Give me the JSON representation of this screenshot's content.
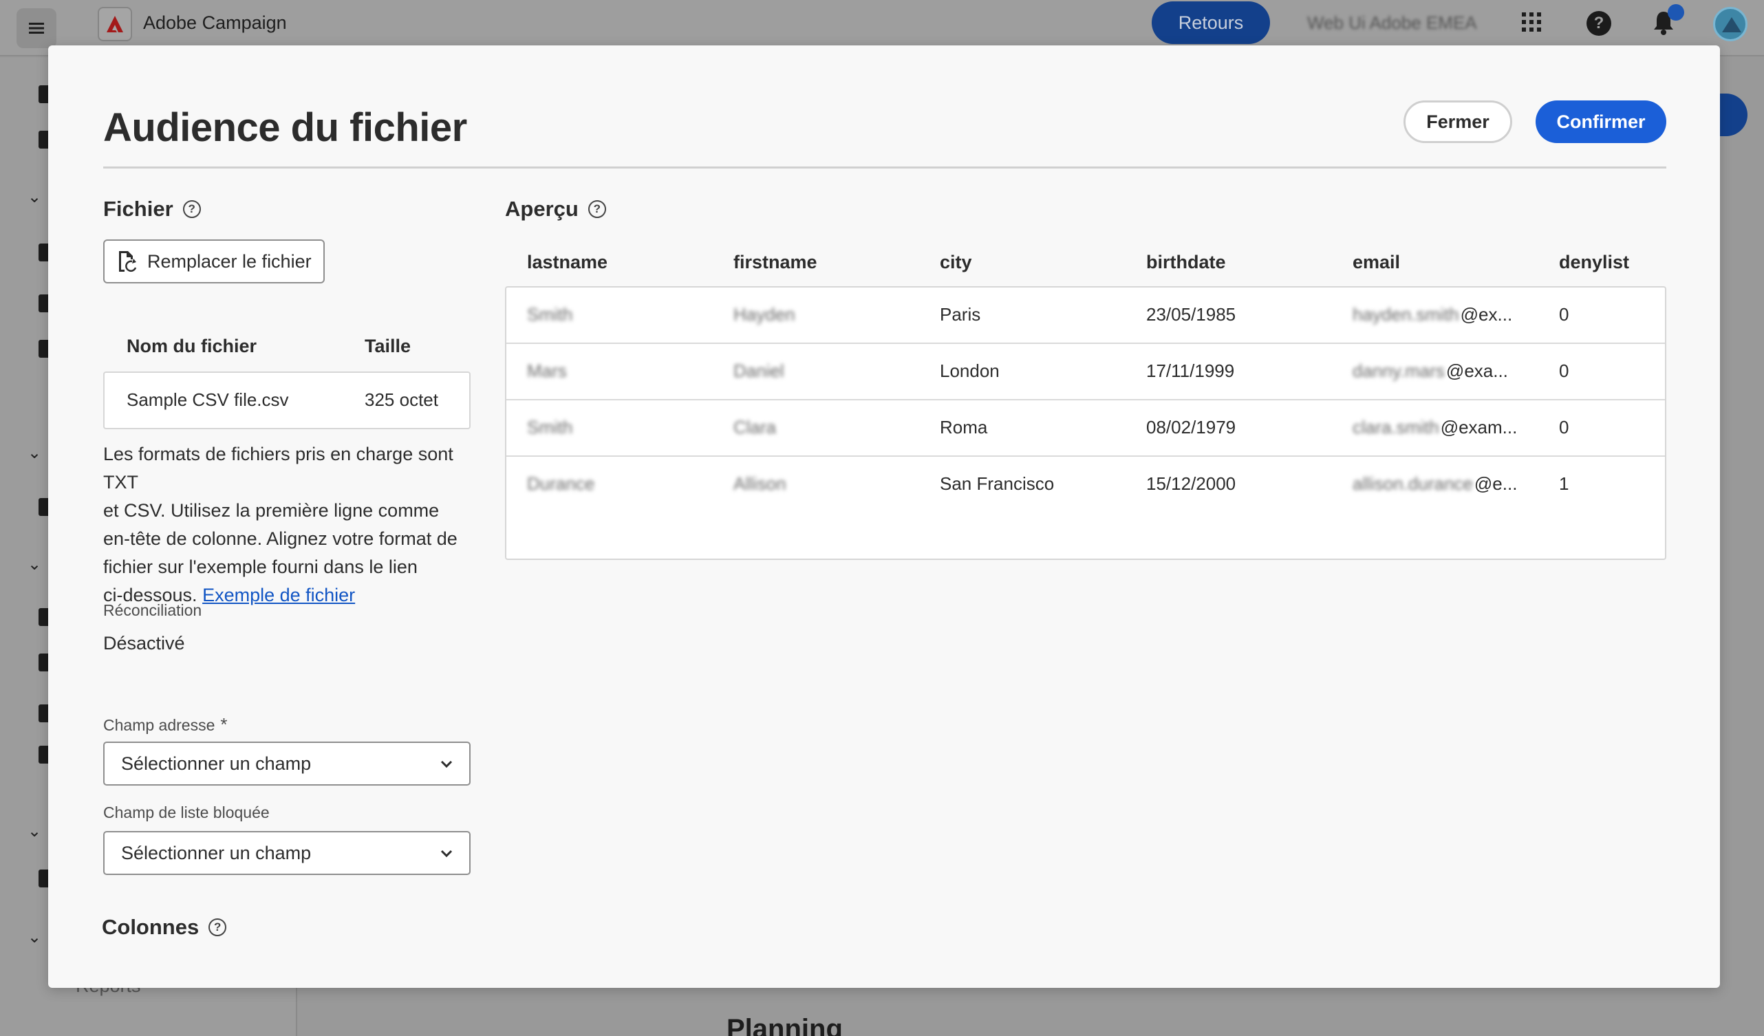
{
  "app": {
    "title": "Adobe Campaign",
    "retours_label": "Retours",
    "org_name": "Web Ui Adobe EMEA",
    "reports_label": "Reports",
    "planning_label": "Planning"
  },
  "modal": {
    "title": "Audience du fichier",
    "close_label": "Fermer",
    "confirm_label": "Confirmer",
    "accent_color": "#1b5fd8"
  },
  "file_section": {
    "heading": "Fichier",
    "replace_label": "Remplacer le fichier",
    "col_name": "Nom du fichier",
    "col_size": "Taille",
    "file_name": "Sample CSV file.csv",
    "file_size": "325 octet",
    "info_line1": "Les formats de fichiers pris en charge sont TXT",
    "info_line2": "et CSV. Utilisez la  première ligne comme",
    "info_line3": "en-tête de colonne. Alignez votre format de",
    "info_line4": "fichier sur l'exemple fourni dans le lien",
    "info_line5": "ci-dessous. ",
    "example_link": "Exemple de fichier",
    "reconciliation_label": "Réconciliation",
    "reconciliation_value": "Désactivé",
    "address_label": "Champ adresse",
    "address_required": "*",
    "address_value": "Sélectionner un champ",
    "denylist_label": "Champ de liste bloquée",
    "denylist_value": "Sélectionner un champ",
    "columns_heading": "Colonnes"
  },
  "preview": {
    "heading": "Aperçu",
    "columns": [
      "lastname",
      "firstname",
      "city",
      "birthdate",
      "email",
      "denylist"
    ],
    "rows": [
      {
        "lastname": "Smith",
        "firstname": "Hayden",
        "city": "Paris",
        "birthdate": "23/05/1985",
        "email_hidden": "hayden.smith",
        "email_visible": "@ex...",
        "denylist": "0"
      },
      {
        "lastname": "Mars",
        "firstname": "Daniel",
        "city": "London",
        "birthdate": "17/11/1999",
        "email_hidden": "danny.mars",
        "email_visible": "@exa...",
        "denylist": "0"
      },
      {
        "lastname": "Smith",
        "firstname": "Clara",
        "city": "Roma",
        "birthdate": "08/02/1979",
        "email_hidden": "clara.smith",
        "email_visible": "@exam...",
        "denylist": "0"
      },
      {
        "lastname": "Durance",
        "firstname": "Allison",
        "city": "San Francisco",
        "birthdate": "15/12/2000",
        "email_hidden": "allison.durance",
        "email_visible": "@e...",
        "denylist": "1"
      }
    ]
  }
}
